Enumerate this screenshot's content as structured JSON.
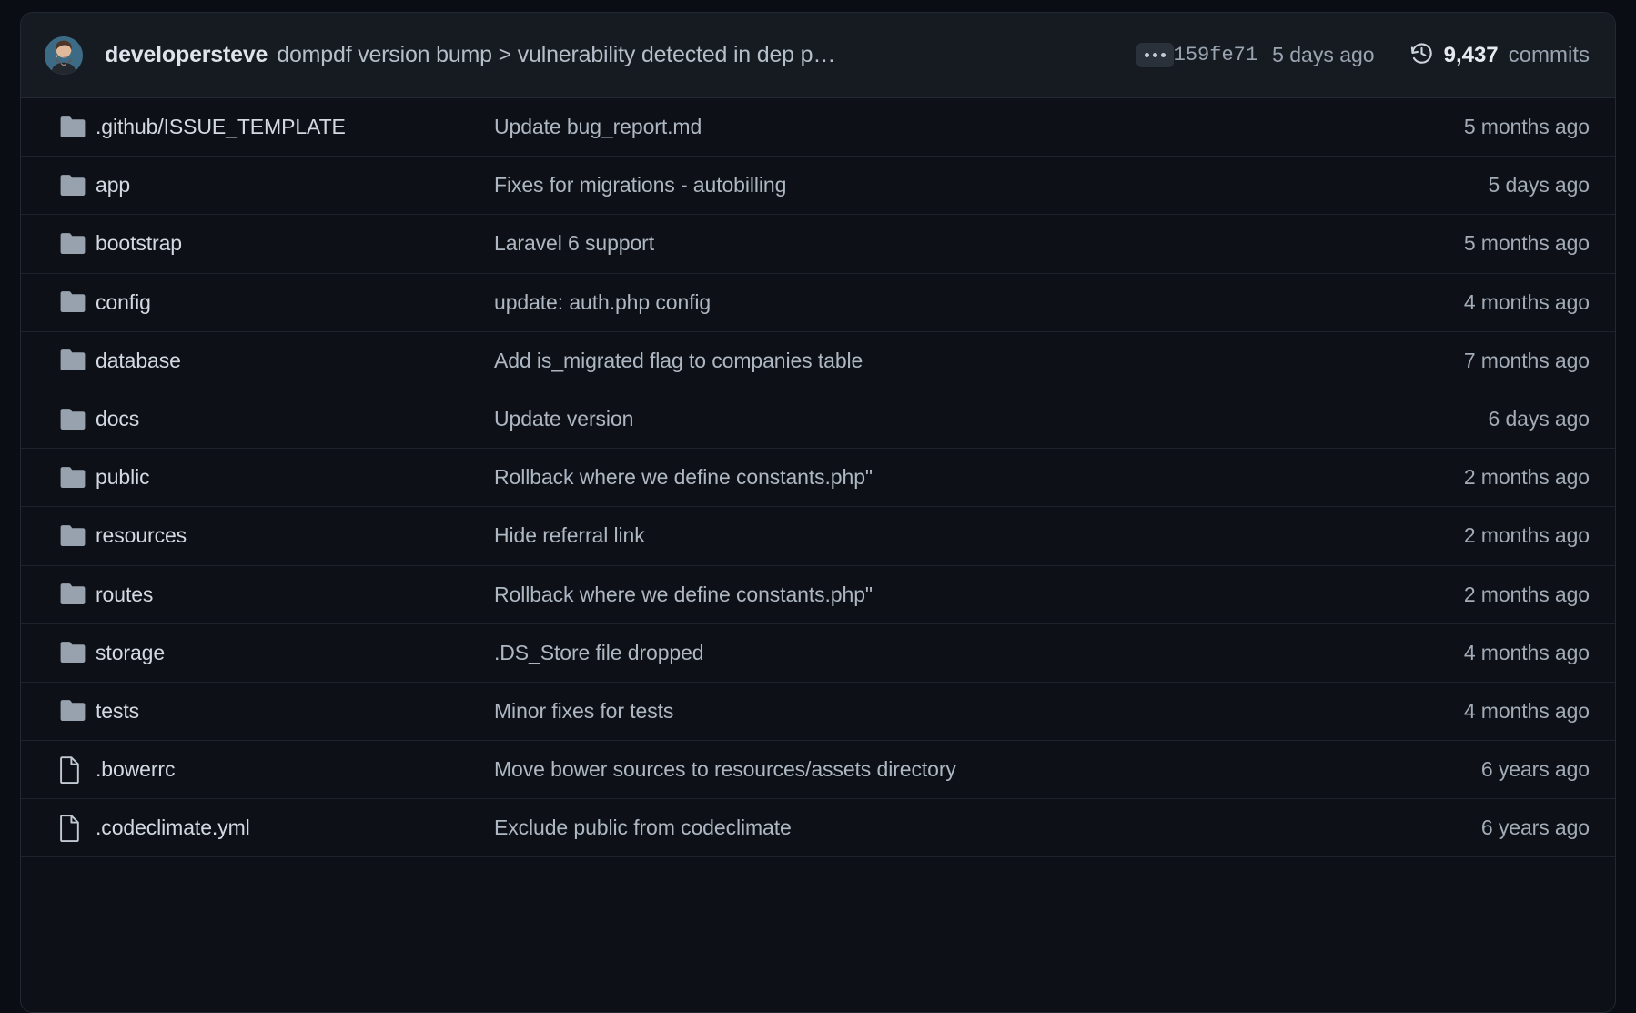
{
  "commit_header": {
    "avatar_name": "avatar",
    "author": "developersteve",
    "message": "dompdf version bump > vulnerability detected in dep php-...",
    "overflow_button_label": "...",
    "sha": "159fe71",
    "date": "5 days ago",
    "commits_icon": "history-icon",
    "commits_count": "9,437",
    "commits_label": "commits"
  },
  "colors": {
    "page_background": "#0a0e14",
    "panel_background": "#0d1117",
    "header_background": "#161b22",
    "border": "#222932",
    "row_border": "#1d232c",
    "folder_icon": "#98a2ae",
    "file_icon": "#c2c9d2",
    "primary_text": "#d3d9e0",
    "muted_text": "#aeb7c2"
  },
  "files": [
    {
      "icon": "folder-icon",
      "type": "folder",
      "name": ".github/ISSUE_TEMPLATE",
      "message": "Update bug_report.md",
      "time": "5 months ago"
    },
    {
      "icon": "folder-icon",
      "type": "folder",
      "name": "app",
      "message": "Fixes for migrations - autobilling",
      "time": "5 days ago"
    },
    {
      "icon": "folder-icon",
      "type": "folder",
      "name": "bootstrap",
      "message": "Laravel 6 support",
      "time": "5 months ago"
    },
    {
      "icon": "folder-icon",
      "type": "folder",
      "name": "config",
      "message": "update: auth.php config",
      "time": "4 months ago"
    },
    {
      "icon": "folder-icon",
      "type": "folder",
      "name": "database",
      "message": "Add is_migrated flag to companies table",
      "time": "7 months ago"
    },
    {
      "icon": "folder-icon",
      "type": "folder",
      "name": "docs",
      "message": "Update version",
      "time": "6 days ago"
    },
    {
      "icon": "folder-icon",
      "type": "folder",
      "name": "public",
      "message": "Rollback where we define constants.php\"",
      "time": "2 months ago"
    },
    {
      "icon": "folder-icon",
      "type": "folder",
      "name": "resources",
      "message": "Hide referral link",
      "time": "2 months ago"
    },
    {
      "icon": "folder-icon",
      "type": "folder",
      "name": "routes",
      "message": "Rollback where we define constants.php\"",
      "time": "2 months ago"
    },
    {
      "icon": "folder-icon",
      "type": "folder",
      "name": "storage",
      "message": ".DS_Store file dropped",
      "time": "4 months ago"
    },
    {
      "icon": "folder-icon",
      "type": "folder",
      "name": "tests",
      "message": "Minor fixes for tests",
      "time": "4 months ago"
    },
    {
      "icon": "file-icon",
      "type": "file",
      "name": ".bowerrc",
      "message": "Move bower sources to resources/assets directory",
      "time": "6 years ago"
    },
    {
      "icon": "file-icon",
      "type": "file",
      "name": ".codeclimate.yml",
      "message": "Exclude public from codeclimate",
      "time": "6 years ago"
    }
  ]
}
